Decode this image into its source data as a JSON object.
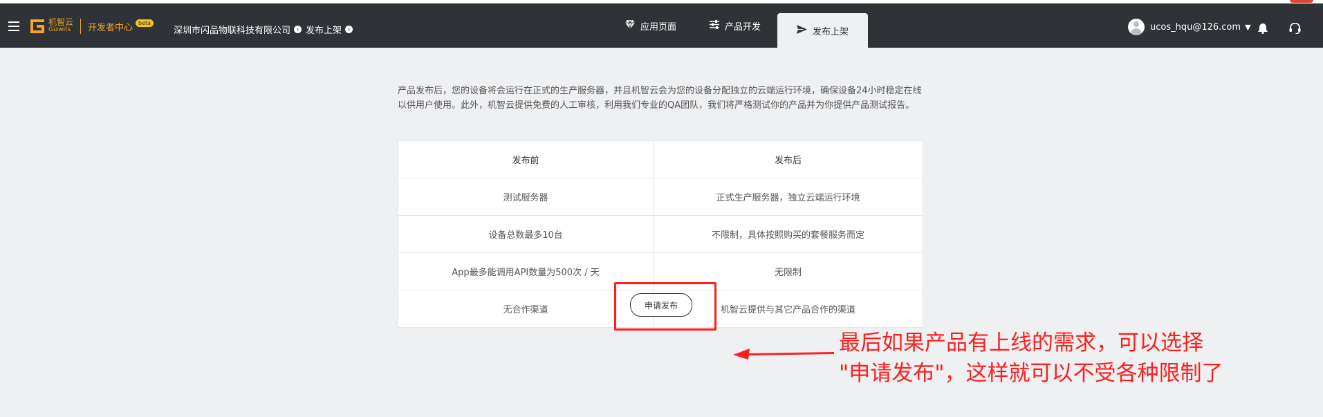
{
  "navbar": {
    "brand_cn": "机智云",
    "brand_en": "Gizwits",
    "dev_center": "开发者中心",
    "beta_badge": "beta",
    "company": "深圳市闪品物联科技有限公司",
    "release_label": "发布上架",
    "tabs": [
      {
        "label": "应用页面",
        "icon": "diamond-icon"
      },
      {
        "label": "产品开发",
        "icon": "sliders-icon"
      },
      {
        "label": "发布上架",
        "icon": "send-icon",
        "active": true
      }
    ],
    "user_email": "ucos_hqu@126.com"
  },
  "main": {
    "description": "产品发布后，您的设备将会运行在正式的生产服务器，并且机智云会为您的设备分配独立的云端运行环境，确保设备24小时稳定在线以供用户使用。此外，机智云提供免费的人工审核，利用我们专业的QA团队，我们将严格测试你的产品并为你提供产品测试报告。",
    "table": {
      "headers": [
        "发布前",
        "发布后"
      ],
      "rows": [
        [
          "测试服务器",
          "正式生产服务器，独立云端运行环境"
        ],
        [
          "设备总数最多10台",
          "不限制，具体按照购买的套餐服务而定"
        ],
        [
          "App最多能调用API数量为500次 / 天",
          "无限制"
        ],
        [
          "无合作渠道",
          "机智云提供与其它产品合作的渠道"
        ]
      ]
    },
    "apply_button": "申请发布"
  },
  "annotation": {
    "line1": "最后如果产品有上线的需求，可以选择",
    "line2": "\"申请发布\"，这样就可以不受各种限制了"
  },
  "colors": {
    "navbar_bg": "#2f3337",
    "brand_accent": "#f5a623",
    "content_bg": "#eff0f2",
    "annotation_red": "#ff1e1e"
  }
}
